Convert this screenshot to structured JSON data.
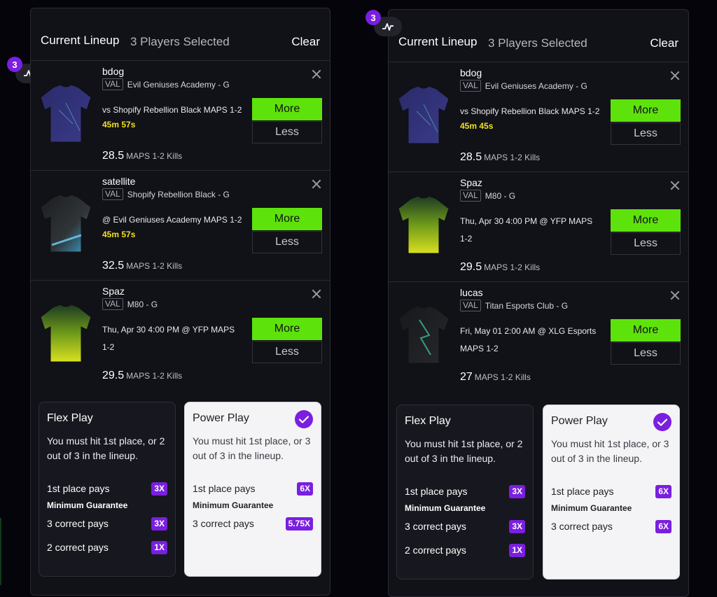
{
  "left_panel": {
    "title": "Current Lineup",
    "selected": "3 Players Selected",
    "clear": "Clear",
    "badge_count": "3",
    "picks": [
      {
        "name": "bdog",
        "game": "VAL",
        "team": "Evil Geniuses Academy - G",
        "matchup": "vs Shopify Rebellion Black MAPS 1-2",
        "timer": "45m 57s",
        "line": "28.5",
        "stat": "MAPS 1-2 Kills",
        "more": "More",
        "less": "Less"
      },
      {
        "name": "satellite",
        "game": "VAL",
        "team": "Shopify Rebellion Black - G",
        "matchup": "@ Evil Geniuses Academy MAPS 1-2",
        "timer": "45m 57s",
        "line": "32.5",
        "stat": "MAPS 1-2 Kills",
        "more": "More",
        "less": "Less"
      },
      {
        "name": "Spaz",
        "game": "VAL",
        "team": "M80 - G",
        "matchup_l1": "Thu, Apr 30 4:00 PM @ YFP MAPS",
        "matchup_l2": "1-2",
        "line": "29.5",
        "stat": "MAPS 1-2 Kills",
        "more": "More",
        "less": "Less"
      }
    ],
    "flex": {
      "name": "Flex Play",
      "desc": "You must hit 1st place, or 2 out of 3 in the lineup.",
      "first_label": "1st place pays",
      "first_mult": "3X",
      "min_guarantee": "Minimum Guarantee",
      "c3_label": "3 correct pays",
      "c3_mult": "3X",
      "c2_label": "2 correct pays",
      "c2_mult": "1X"
    },
    "power": {
      "name": "Power Play",
      "desc": "You must hit 1st place, or 3 out of 3 in the lineup.",
      "first_label": "1st place pays",
      "first_mult": "6X",
      "min_guarantee": "Minimum Guarantee",
      "c3_label": "3 correct pays",
      "c3_mult": "5.75X"
    }
  },
  "right_panel": {
    "title": "Current Lineup",
    "selected": "3 Players Selected",
    "clear": "Clear",
    "badge_count": "3",
    "picks": [
      {
        "name": "bdog",
        "game": "VAL",
        "team": "Evil Geniuses Academy - G",
        "matchup": "vs Shopify Rebellion Black MAPS 1-2",
        "timer": "45m 45s",
        "line": "28.5",
        "stat": "MAPS 1-2 Kills",
        "more": "More",
        "less": "Less"
      },
      {
        "name": "Spaz",
        "game": "VAL",
        "team": "M80 - G",
        "matchup_l1": "Thu, Apr 30 4:00 PM @ YFP MAPS",
        "matchup_l2": "1-2",
        "line": "29.5",
        "stat": "MAPS 1-2 Kills",
        "more": "More",
        "less": "Less"
      },
      {
        "name": "lucas",
        "game": "VAL",
        "team": "Titan Esports Club - G",
        "matchup_l1": "Fri, May 01 2:00 AM @ XLG Esports",
        "matchup_l2": "MAPS 1-2",
        "line": "27",
        "stat": "MAPS 1-2 Kills",
        "more": "More",
        "less": "Less"
      }
    ],
    "flex": {
      "name": "Flex Play",
      "desc": "You must hit 1st place, or 2 out of 3 in the lineup.",
      "first_label": "1st place pays",
      "first_mult": "3X",
      "min_guarantee": "Minimum Guarantee",
      "c3_label": "3 correct pays",
      "c3_mult": "3X",
      "c2_label": "2 correct pays",
      "c2_mult": "1X"
    },
    "power": {
      "name": "Power Play",
      "desc": "You must hit 1st place, or 3 out of 3 in the lineup.",
      "first_label": "1st place pays",
      "first_mult": "6X",
      "min_guarantee": "Minimum Guarantee",
      "c3_label": "3 correct pays",
      "c3_mult": "6X"
    }
  },
  "colors": {
    "accent_purple": "#7a1fe0",
    "more_green": "#5ee20b",
    "timer_yellow": "#f0e020"
  },
  "icons": [
    "activity-icon",
    "close-icon",
    "checkmark-icon",
    "jersey-icon"
  ]
}
